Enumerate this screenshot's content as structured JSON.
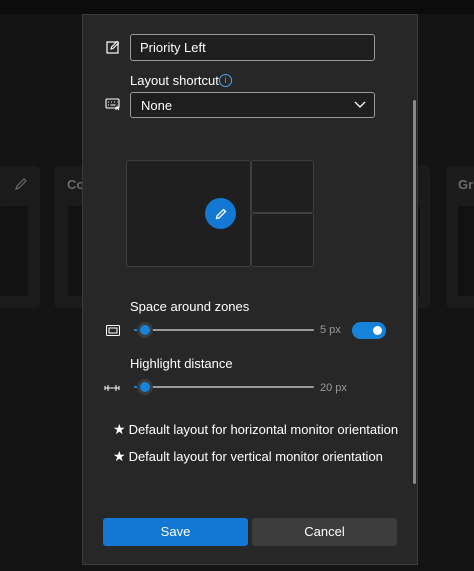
{
  "background": {
    "left_card_text": "Co",
    "right_card_text": "Gr"
  },
  "dialog": {
    "name_value": "Priority Left",
    "shortcut_label": "Layout shortcut",
    "shortcut_value": "None",
    "spacing_label": "Space around zones",
    "spacing_value": "5 px",
    "spacing_slider_fraction": 0.06,
    "spacing_enabled": true,
    "highlight_label": "Highlight distance",
    "highlight_value": "20 px",
    "highlight_slider_fraction": 0.06,
    "default_horizontal": "Default layout for horizontal monitor orientation",
    "default_vertical": "Default layout for vertical monitor orientation",
    "star_glyph": "★",
    "info_glyph": "i",
    "save_label": "Save",
    "cancel_label": "Cancel"
  },
  "colors": {
    "accent": "#1278d3",
    "dialog_bg": "#272727",
    "page_bg": "#141414"
  },
  "icons": [
    "edit-icon",
    "info-icon",
    "keyboard-icon",
    "chevron-down-icon",
    "pencil-icon",
    "spacing-icon",
    "highlight-distance-icon",
    "star-icon"
  ]
}
